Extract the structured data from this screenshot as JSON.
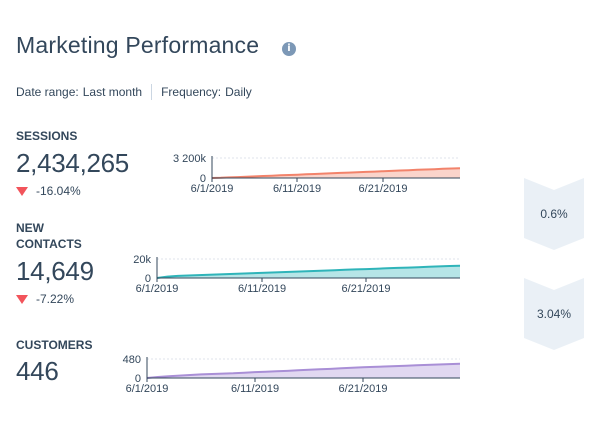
{
  "header": {
    "title": "Marketing Performance",
    "info_icon": "info-icon"
  },
  "filters": {
    "date_range_label": "Date range:",
    "date_range_value": "Last month",
    "frequency_label": "Frequency:",
    "frequency_value": "Daily"
  },
  "metrics": [
    {
      "label": "SESSIONS",
      "value": "2,434,265",
      "change": "-16.04%"
    },
    {
      "label_lines": [
        "NEW",
        "CONTACTS"
      ],
      "value": "14,649",
      "change": "-7.22%"
    },
    {
      "label": "CUSTOMERS",
      "value": "446"
    }
  ],
  "conversions": [
    "0.6%",
    "3.04%"
  ],
  "colors": {
    "sessions": "#f2836b",
    "contacts": "#2fb4b9",
    "customers": "#a98fd6",
    "negative": "#f2545b",
    "chevron_bg": "#eaf0f6"
  },
  "chart_data": [
    {
      "type": "area",
      "x_ticks": [
        "6/1/2019",
        "6/11/2019",
        "6/21/2019"
      ],
      "y_ticks": [
        "0",
        "3 200k"
      ],
      "y_max": 3200000,
      "series": [
        {
          "values": [
            0,
            40000,
            95000,
            150000,
            205000,
            260000,
            315000,
            370000,
            425000,
            480000,
            535000,
            590000,
            645000,
            700000,
            755000,
            810000,
            865000,
            920000,
            975000,
            1030000,
            1085000,
            1140000,
            1195000,
            1250000,
            1305000,
            1360000,
            1415000,
            1470000,
            1525000,
            1575000
          ]
        }
      ]
    },
    {
      "type": "area",
      "x_ticks": [
        "6/1/2019",
        "6/11/2019",
        "6/21/2019"
      ],
      "y_ticks": [
        "0",
        "20k"
      ],
      "y_max": 20000,
      "series": [
        {
          "values": [
            0,
            1500,
            2200,
            2600,
            3000,
            3400,
            3800,
            4200,
            4600,
            5000,
            5400,
            5800,
            6200,
            6600,
            7000,
            7400,
            7800,
            8200,
            8600,
            9000,
            9400,
            9800,
            10200,
            10600,
            11000,
            11400,
            11800,
            12200,
            12600,
            13000
          ]
        }
      ]
    },
    {
      "type": "area",
      "x_ticks": [
        "6/1/2019",
        "6/11/2019",
        "6/21/2019"
      ],
      "y_ticks": [
        "0",
        "480"
      ],
      "y_max": 480,
      "series": [
        {
          "values": [
            0,
            25,
            45,
            60,
            75,
            90,
            100,
            110,
            120,
            135,
            150,
            160,
            170,
            180,
            195,
            210,
            220,
            230,
            245,
            260,
            270,
            280,
            290,
            300,
            310,
            320,
            330,
            340,
            350,
            360
          ]
        }
      ]
    }
  ]
}
